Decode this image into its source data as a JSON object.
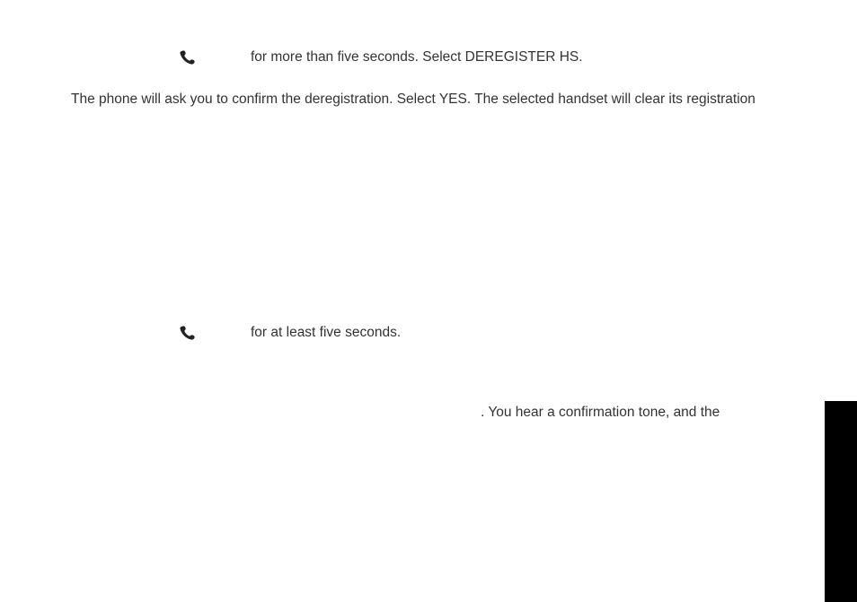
{
  "doc": {
    "line1_tail": "for more than five seconds. Select DEREGISTER HS.",
    "line2": "The phone will ask you to confirm the deregistration. Select YES. The selected handset will clear its registration",
    "line3_tail": "for at least five seconds.",
    "line4_tail": ". You hear a confirmation tone, and the"
  },
  "icons": {
    "handset": "handset-icon"
  }
}
